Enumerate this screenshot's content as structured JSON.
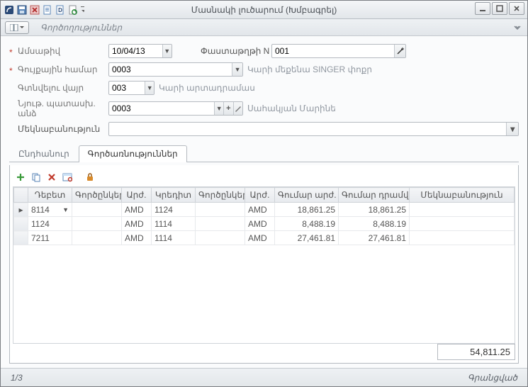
{
  "window": {
    "title": "Մասնակի լուծարում (Խմբագրել)"
  },
  "secbar": {
    "title": "Գործողություններ"
  },
  "form": {
    "date_label": "Ամսաթիվ",
    "date_value": "10/04/13",
    "docnum_label": "Փաստաթղթի N",
    "docnum_value": "001",
    "invnum_label": "Գույքային համար",
    "invnum_value": "0003",
    "invnum_text": "Կարի մեքենա SINGER փոքր",
    "loc_label": "Գտնվելու վայր",
    "loc_value": "003",
    "loc_text": "Կարի արտադրամաս",
    "resp_label": "Նյութ. պատասխ. անձ",
    "resp_value": "0003",
    "resp_text": "Սահակյան Մարինե",
    "comment_label": "Մեկնաբանություն",
    "comment_value": ""
  },
  "tabs": {
    "general": "Ընդհանուր",
    "ops": "Գործառնություններ"
  },
  "grid": {
    "headers": {
      "debit": "Դեբետ",
      "partners1": "Գործընկեր",
      "cur1": "Արժ.",
      "credit": "Կրեդիտ",
      "partners2": "Գործընկեր",
      "cur2": "Արժ.",
      "amount_cur": "Գումար արժ.",
      "amount_dram": "Գումար դրամվ",
      "comment": "Մեկնաբանություն"
    },
    "rows": [
      {
        "debit": "8114",
        "p1": "",
        "cur1": "AMD",
        "credit": "1124",
        "p2": "",
        "cur2": "AMD",
        "amt_cur": "18,861.25",
        "amt_dram": "18,861.25",
        "comment": ""
      },
      {
        "debit": "1124",
        "p1": "",
        "cur1": "AMD",
        "credit": "1114",
        "p2": "",
        "cur2": "AMD",
        "amt_cur": "8,488.19",
        "amt_dram": "8,488.19",
        "comment": ""
      },
      {
        "debit": "7211",
        "p1": "",
        "cur1": "AMD",
        "credit": "1114",
        "p2": "",
        "cur2": "AMD",
        "amt_cur": "27,461.81",
        "amt_dram": "27,461.81",
        "comment": ""
      }
    ],
    "total": "54,811.25"
  },
  "status": {
    "left": "1/3",
    "right": "Գրանցված"
  }
}
